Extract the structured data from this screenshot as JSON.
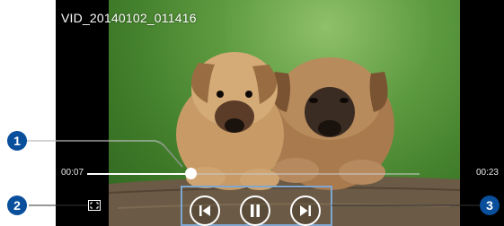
{
  "player": {
    "title": "VID_20140102_011416",
    "current_time": "00:07",
    "total_time": "00:23",
    "progress": 0.31
  },
  "controls": {
    "previous_icon": "skip-previous-icon",
    "pause_icon": "pause-icon",
    "next_icon": "skip-next-icon",
    "aspect_icon": "screen-ratio-icon"
  },
  "callouts": [
    "1",
    "2",
    "3"
  ],
  "colors": {
    "callout": "#0a4f9c",
    "controls_outline": "#7fa7d0"
  }
}
